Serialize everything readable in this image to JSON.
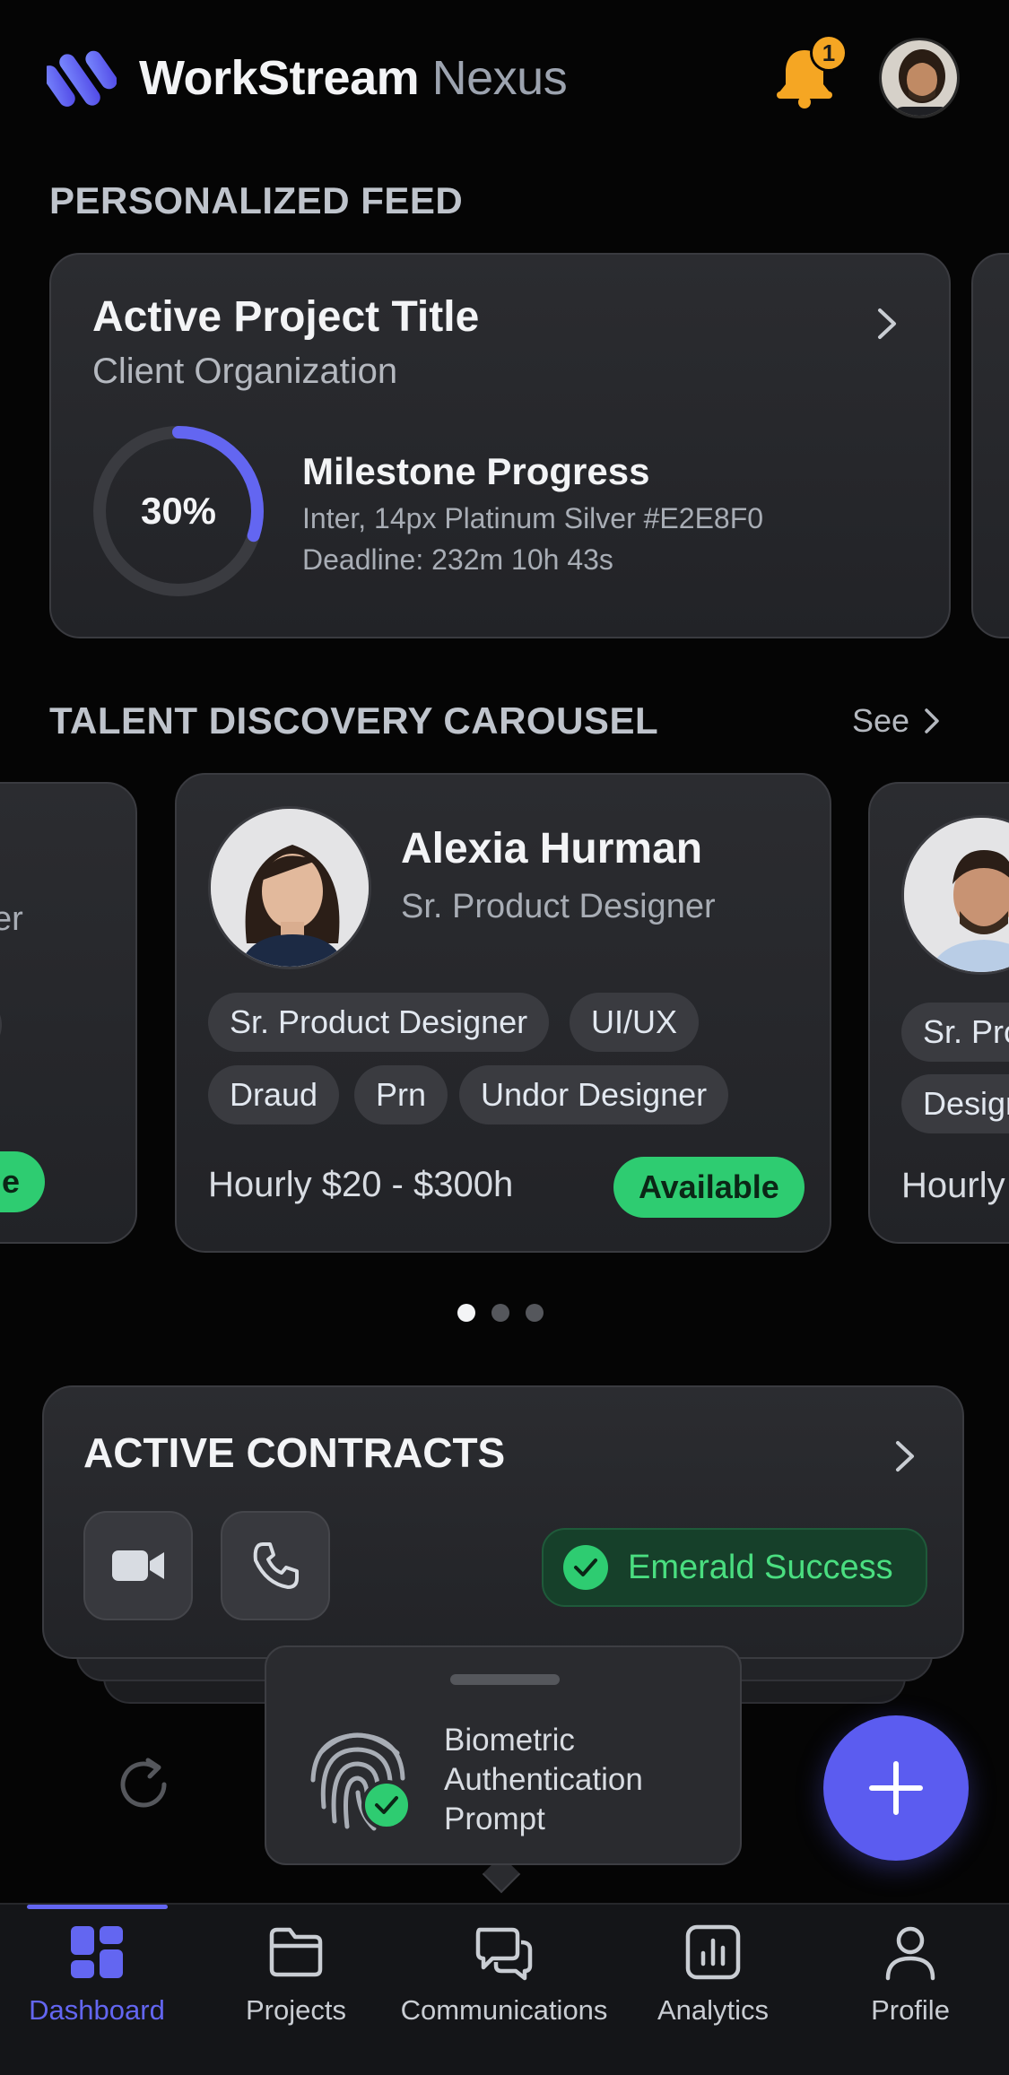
{
  "header": {
    "title_main": "WorkStream",
    "title_sub": "Nexus",
    "notification_count": "1"
  },
  "feed": {
    "section_title": "PERSONALIZED FEED",
    "project": {
      "title": "Active Project Title",
      "client": "Client Organization",
      "progress_label": "30%",
      "progress_fraction": 0.3,
      "milestone_title": "Milestone Progress",
      "milestone_line1": "Inter, 14px Platinum Silver #E2E8F0",
      "milestone_line2": "Deadline: 232m 10h 43s"
    }
  },
  "talent": {
    "section_title": "TALENT DISCOVERY CAROUSEL",
    "see_label": "See",
    "left_card": {
      "role_fragment": "er",
      "tag1": "ner",
      "tag2": "er",
      "avail_fragment": "ilable"
    },
    "main_card": {
      "name": "Alexia Hurman",
      "role": "Sr. Product Designer",
      "tags": [
        "Sr. Product Designer",
        "UI/UX",
        "Draud",
        "Prn",
        "Undor Designer"
      ],
      "rate": "Hourly $20 - $300h",
      "availability": "Available"
    },
    "right_card": {
      "tag1": "Sr. Pro",
      "tag2": "Design",
      "rate": "Hourly"
    },
    "pagination": {
      "count": 3,
      "active_index": 0
    }
  },
  "contracts": {
    "title": "ACTIVE CONTRACTS",
    "status_label": "Emerald Success"
  },
  "biometric": {
    "line1": "Biometric",
    "line2": "Authentication",
    "line3": "Prompt"
  },
  "nav": {
    "items": [
      {
        "label": "Dashboard",
        "icon": "dashboard-icon",
        "active": true
      },
      {
        "label": "Projects",
        "icon": "folder-icon",
        "active": false
      },
      {
        "label": "Communications",
        "icon": "chat-icon",
        "active": false
      },
      {
        "label": "Analytics",
        "icon": "analytics-icon",
        "active": false
      },
      {
        "label": "Profile",
        "icon": "profile-icon",
        "active": false
      }
    ]
  },
  "colors": {
    "accent": "#5B5CF0",
    "nav_active": "#6366F1",
    "success": "#2ECC71",
    "notification": "#F5A623",
    "text_primary": "#E2E8F0"
  }
}
